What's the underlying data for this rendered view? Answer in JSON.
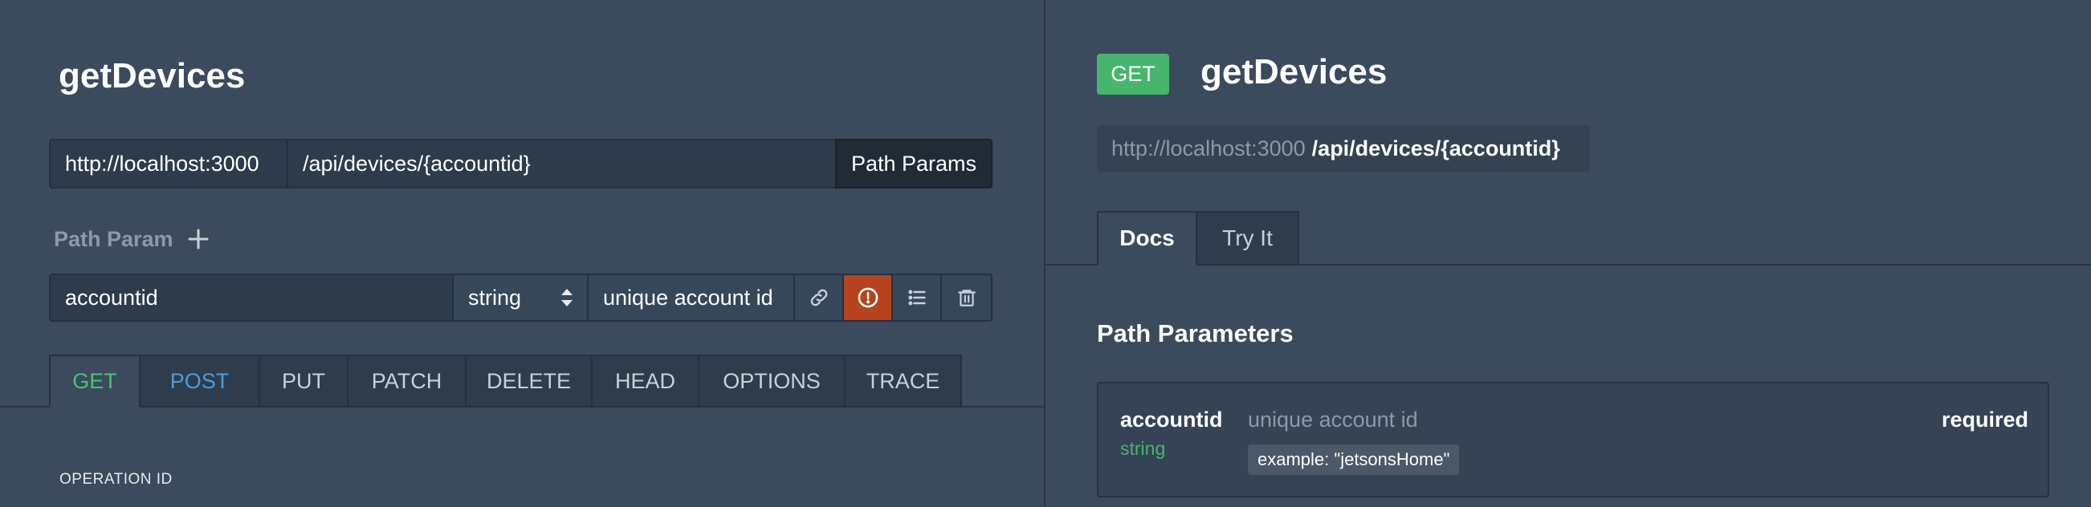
{
  "editor": {
    "title": "getDevices",
    "base_url": "http://localhost:3000",
    "path": "/api/devices/{accountid}",
    "path_params_button": "Path Params",
    "path_param_section_label": "Path Param",
    "add_icon": "plus-icon",
    "param_row": {
      "name": "accountid",
      "type": "string",
      "description": "unique account id",
      "icons": [
        "link-icon",
        "alert-circle-icon",
        "list-icon",
        "trash-icon"
      ]
    },
    "methods": [
      "GET",
      "POST",
      "PUT",
      "PATCH",
      "DELETE",
      "HEAD",
      "OPTIONS",
      "TRACE"
    ],
    "active_method": "GET",
    "operation_id_label": "OPERATION ID"
  },
  "docs": {
    "method_badge": "GET",
    "title": "getDevices",
    "url_host": "http://localhost:3000",
    "url_path": "/api/devices/{accountid}",
    "tabs": [
      "Docs",
      "Try It"
    ],
    "active_tab": "Docs",
    "section_title": "Path Parameters",
    "param": {
      "name": "accountid",
      "type": "string",
      "description": "unique account id",
      "required_label": "required",
      "example": "example: \"jetsonsHome\""
    }
  },
  "colors": {
    "background": "#3b4a5c",
    "get": "#46b66d",
    "post": "#4a9de0",
    "danger": "#b6431e"
  }
}
